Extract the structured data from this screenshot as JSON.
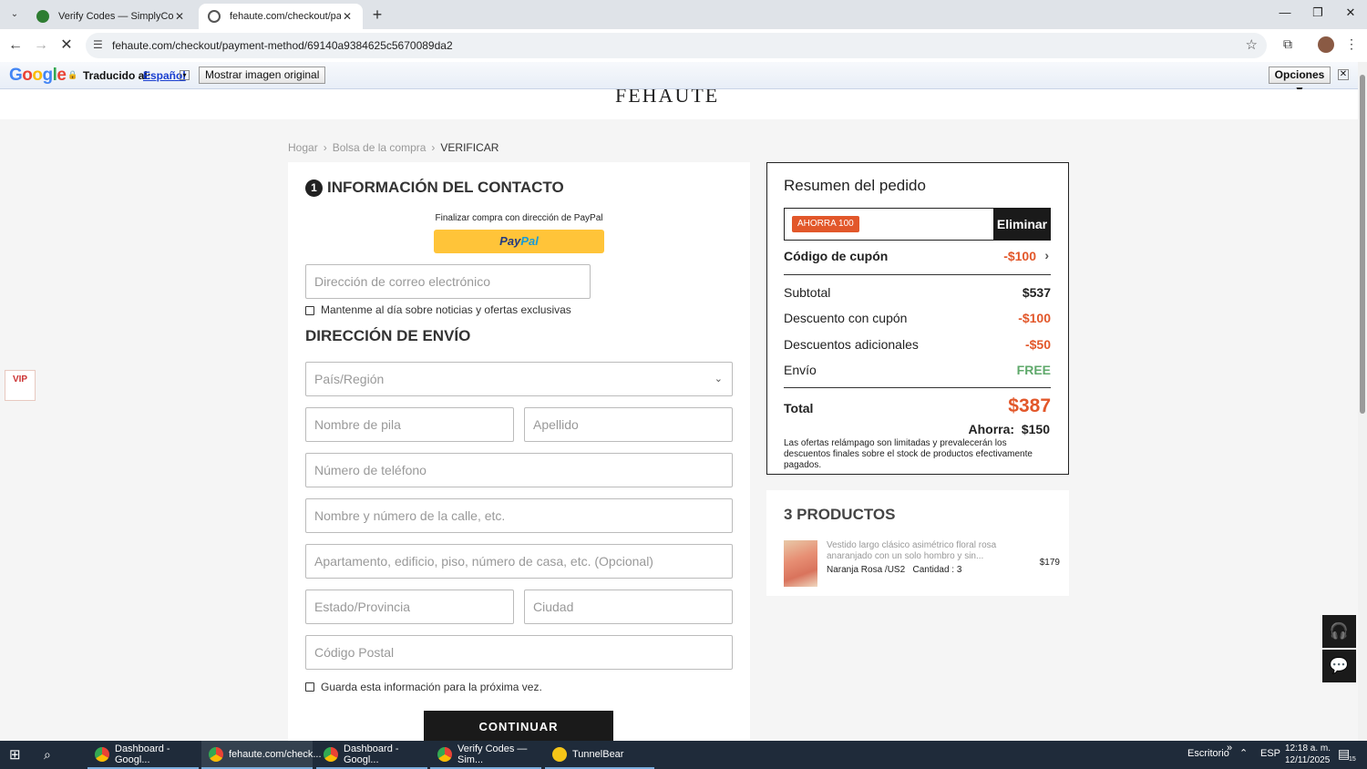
{
  "browser": {
    "tabs": [
      {
        "title": "Verify Codes — SimplyCodes",
        "active": false,
        "favicon_color": "#2e7d32"
      },
      {
        "title": "fehaute.com/checkout/paymen",
        "active": true,
        "favicon_color": "#555555"
      }
    ],
    "url": "fehaute.com/checkout/payment-method/69140a9384625c5670089da2"
  },
  "translate_bar": {
    "label": "Traducido al:",
    "language": "Español",
    "show_original": "Mostrar imagen original",
    "options": "Opciones ▼"
  },
  "site": {
    "logo_fragment": "FEHAUTE"
  },
  "breadcrumb": [
    "Hogar",
    "Bolsa de la compra",
    "VERIFICAR"
  ],
  "contact": {
    "step": "1",
    "title": "INFORMACIÓN DEL CONTACTO",
    "paypal_caption": "Finalizar compra con dirección de PayPal",
    "paypal_pay": "Pay",
    "paypal_pal": "Pal",
    "email_placeholder": "Dirección de correo electrónico",
    "newsletter_label": "Mantenme al día sobre noticias y ofertas exclusivas"
  },
  "shipping": {
    "title": "DIRECCIÓN DE ENVÍO",
    "country_placeholder": "País/Región",
    "first_name_placeholder": "Nombre de pila",
    "last_name_placeholder": "Apellido",
    "phone_placeholder": "Número de teléfono",
    "street_placeholder": "Nombre y número de la calle, etc.",
    "apartment_placeholder": "Apartamento, edificio, piso, número de casa, etc. (Opcional)",
    "state_placeholder": "Estado/Provincia",
    "city_placeholder": "Ciudad",
    "postal_placeholder": "Código Postal",
    "save_info_label": "Guarda esta información para la próxima vez.",
    "continue_label": "CONTINUAR"
  },
  "summary": {
    "title": "Resumen del pedido",
    "coupon_tag": "AHORRA 100",
    "remove_label": "Eliminar",
    "coupon_label": "Código de cupón",
    "coupon_value": "-$100",
    "rows": [
      {
        "label": "Subtotal",
        "value": "$537"
      },
      {
        "label": "Descuento con cupón",
        "value": "-$100"
      },
      {
        "label": "Descuentos adicionales",
        "value": "-$50"
      },
      {
        "label": "Envío",
        "value": "FREE"
      }
    ],
    "total_label": "Total",
    "total_value": "$387",
    "save_text": "Ahorra:  $150",
    "note": "Las ofertas relámpago son limitadas y prevalecerán los descuentos finales sobre el stock de productos efectivamente pagados."
  },
  "products": {
    "title": "3 PRODUCTOS",
    "items": [
      {
        "name": "Vestido largo clásico asimétrico floral rosa anaranjado con un solo hombro y sin...",
        "meta": "Naranja Rosa /US2   Cantidad : 3",
        "price": "$179"
      }
    ]
  },
  "vip_badge": "VIP",
  "taskbar": {
    "items": [
      {
        "label": "Dashboard - Googl..."
      },
      {
        "label": "fehaute.com/check..."
      },
      {
        "label": "Dashboard - Googl..."
      },
      {
        "label": "Verify Codes — Sim..."
      },
      {
        "label": "TunnelBear"
      }
    ],
    "desktop_label": "Escritorio",
    "lang": "ESP",
    "time": "12:18 a. m.",
    "date": "12/11/2025",
    "notif_count": "15"
  },
  "colors": {
    "accent_red": "#e2572a",
    "free_green": "#5fa96b",
    "paypal_yellow": "#ffc439"
  }
}
